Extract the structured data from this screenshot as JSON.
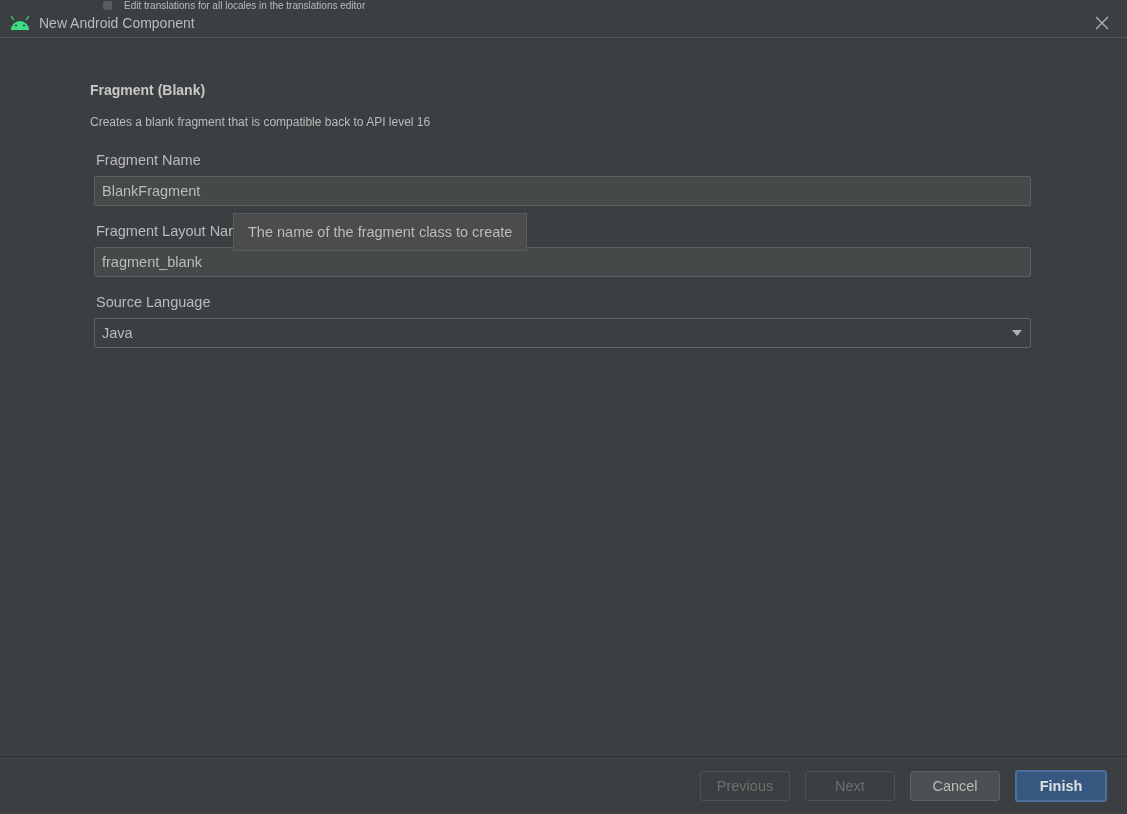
{
  "background_option": {
    "label": "Edit translations for all locales in the translations editor",
    "checked": false
  },
  "window": {
    "title": "New Android Component"
  },
  "template": {
    "title": "Fragment (Blank)",
    "description": "Creates a blank fragment that is compatible back to API level 16"
  },
  "fields": [
    {
      "kind": "text",
      "label": "Fragment Name",
      "value": "BlankFragment"
    },
    {
      "kind": "text",
      "label": "Fragment Layout Nar",
      "value": "fragment_blank"
    },
    {
      "kind": "dropdown",
      "label": "Source Language",
      "value": "Java"
    }
  ],
  "tooltip": {
    "text": "The name of the fragment class to create"
  },
  "buttons": [
    {
      "label": "Previous",
      "disabled": true,
      "kind": "normal"
    },
    {
      "label": "Next",
      "disabled": true,
      "kind": "normal"
    },
    {
      "label": "Cancel",
      "disabled": false,
      "kind": "normal"
    },
    {
      "label": "Finish",
      "disabled": false,
      "kind": "default"
    }
  ]
}
